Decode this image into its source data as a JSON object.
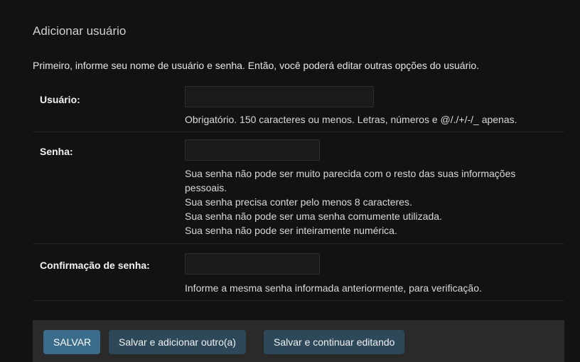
{
  "form": {
    "title": "Adicionar usuário",
    "intro": "Primeiro, informe seu nome de usuário e senha. Então, você poderá editar outras opções do usuário."
  },
  "fields": {
    "username": {
      "label": "Usuário:",
      "value": "",
      "help": "Obrigatório. 150 caracteres ou menos. Letras, números e @/./+/-/_ apenas."
    },
    "password": {
      "label": "Senha:",
      "value": "",
      "help": [
        "Sua senha não pode ser muito parecida com o resto das suas informações pessoais.",
        "Sua senha precisa conter pelo menos 8 caracteres.",
        "Sua senha não pode ser uma senha comumente utilizada.",
        "Sua senha não pode ser inteiramente numérica."
      ]
    },
    "password_confirm": {
      "label": "Confirmação de senha:",
      "value": "",
      "help": "Informe a mesma senha informada anteriormente, para verificação."
    }
  },
  "actions": {
    "save": "SALVAR",
    "save_add_another": "Salvar e adicionar outro(a)",
    "save_continue": "Salvar e continuar editando"
  },
  "colors": {
    "background": "#121212",
    "primary_button": "#3a6d8c",
    "secondary_button": "#2c4859",
    "submit_bar": "#2a2a2a"
  }
}
